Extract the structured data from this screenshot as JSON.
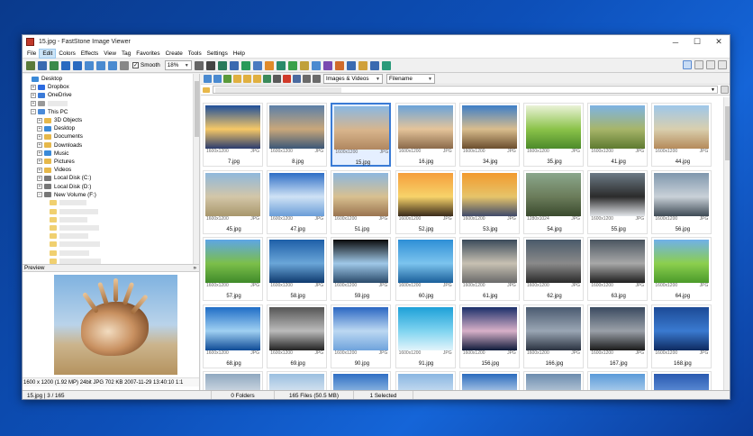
{
  "window": {
    "title": "15.jpg - FastStone Image Viewer",
    "controls": [
      "─",
      "☐",
      "✕"
    ]
  },
  "menu": [
    "File",
    "Edit",
    "Colors",
    "Effects",
    "View",
    "Tag",
    "Favorites",
    "Create",
    "Tools",
    "Settings",
    "Help"
  ],
  "toolbar": {
    "smooth_label": "Smooth",
    "smooth_checked": true,
    "zoom": "18%"
  },
  "nav": {
    "filter": "Images & Videos",
    "sort": "Filename"
  },
  "tree": {
    "items": [
      {
        "label": "Desktop",
        "exp": "",
        "indent": 0,
        "icon": "desktop"
      },
      {
        "label": "Dropbox",
        "exp": "+",
        "indent": 1,
        "icon": "dropbox"
      },
      {
        "label": "OneDrive",
        "exp": "+",
        "indent": 1,
        "icon": "cloud"
      },
      {
        "label": "",
        "exp": "+",
        "indent": 1,
        "icon": "user"
      },
      {
        "label": "This PC",
        "exp": "−",
        "indent": 1,
        "icon": "pc"
      },
      {
        "label": "3D Objects",
        "exp": "+",
        "indent": 2,
        "icon": "folder"
      },
      {
        "label": "Desktop",
        "exp": "+",
        "indent": 2,
        "icon": "desktop"
      },
      {
        "label": "Documents",
        "exp": "+",
        "indent": 2,
        "icon": "folder"
      },
      {
        "label": "Downloads",
        "exp": "+",
        "indent": 2,
        "icon": "folder"
      },
      {
        "label": "Music",
        "exp": "+",
        "indent": 2,
        "icon": "music"
      },
      {
        "label": "Pictures",
        "exp": "+",
        "indent": 2,
        "icon": "folder"
      },
      {
        "label": "Videos",
        "exp": "+",
        "indent": 2,
        "icon": "folder"
      },
      {
        "label": "Local Disk (C:)",
        "exp": "+",
        "indent": 2,
        "icon": "disk"
      },
      {
        "label": "Local Disk (D:)",
        "exp": "+",
        "indent": 2,
        "icon": "disk"
      },
      {
        "label": "New Volume (F:)",
        "exp": "−",
        "indent": 2,
        "icon": "disk"
      }
    ]
  },
  "preview": {
    "title": "Preview",
    "info": "1600 x 1200 (1.92 MP)  24bit  JPG  702 KB  2007-11-29 13:40:10  1:1"
  },
  "thumbnails": [
    {
      "name": "7.jpg",
      "dims": "1600x1200",
      "fmt": "JPG",
      "c": [
        "#1f4f9a",
        "#f6c866",
        "#2a3b6e"
      ]
    },
    {
      "name": "8.jpg",
      "dims": "1600x1200",
      "fmt": "JPG",
      "c": [
        "#5b7fa8",
        "#c9a77a",
        "#3b5778"
      ]
    },
    {
      "name": "15.jpg",
      "dims": "1600x1200",
      "fmt": "JPG",
      "c": [
        "#8ab8e3",
        "#d8b58c",
        "#b08760"
      ],
      "sel": true
    },
    {
      "name": "16.jpg",
      "dims": "1600x1200",
      "fmt": "JPG",
      "c": [
        "#6aa3d9",
        "#e4c49a",
        "#8b6a4a"
      ]
    },
    {
      "name": "34.jpg",
      "dims": "1600x1200",
      "fmt": "JPG",
      "c": [
        "#3d7ec7",
        "#d9bd8d",
        "#6b4e2e"
      ]
    },
    {
      "name": "35.jpg",
      "dims": "1600x1200",
      "fmt": "JPG",
      "c": [
        "#eaf2d8",
        "#8bc34a",
        "#4c8a2a"
      ]
    },
    {
      "name": "41.jpg",
      "dims": "1600x1200",
      "fmt": "JPG",
      "c": [
        "#7db3e4",
        "#a7b56a",
        "#5e7a30"
      ]
    },
    {
      "name": "44.jpg",
      "dims": "1600x1200",
      "fmt": "JPG",
      "c": [
        "#9ec7ea",
        "#d9cfae",
        "#b58a5a"
      ]
    },
    {
      "name": "45.jpg",
      "dims": "1600x1200",
      "fmt": "JPG",
      "c": [
        "#8fb8dc",
        "#d3c6a8",
        "#a8976c"
      ]
    },
    {
      "name": "47.jpg",
      "dims": "1600x1200",
      "fmt": "JPG",
      "c": [
        "#2e6ec6",
        "#cfe2f5",
        "#6a9dd8"
      ]
    },
    {
      "name": "51.jpg",
      "dims": "1600x1200",
      "fmt": "JPG",
      "c": [
        "#8db7de",
        "#d8c090",
        "#9a7450"
      ]
    },
    {
      "name": "52.jpg",
      "dims": "1600x1200",
      "fmt": "JPG",
      "c": [
        "#f59e3b",
        "#f7d36a",
        "#3a2a1a"
      ]
    },
    {
      "name": "53.jpg",
      "dims": "1600x1200",
      "fmt": "JPG",
      "c": [
        "#f29a2e",
        "#e6c46a",
        "#3f4a6a"
      ]
    },
    {
      "name": "54.jpg",
      "dims": "1280x1024",
      "fmt": "JPG",
      "c": [
        "#8aa78c",
        "#6b7c5a",
        "#3a4a2e"
      ]
    },
    {
      "name": "55.jpg",
      "dims": "1600x1200",
      "fmt": "JPG",
      "c": [
        "#6c7a86",
        "#2b2b2b",
        "#e3e6ea"
      ]
    },
    {
      "name": "56.jpg",
      "dims": "1600x1200",
      "fmt": "JPG",
      "c": [
        "#7f97ad",
        "#c9d1d8",
        "#3e4a55"
      ]
    },
    {
      "name": "57.jpg",
      "dims": "1600x1200",
      "fmt": "JPG",
      "c": [
        "#5da5e6",
        "#7cbf4a",
        "#3f8a2a"
      ]
    },
    {
      "name": "58.jpg",
      "dims": "1600x1200",
      "fmt": "JPG",
      "c": [
        "#1e5fa8",
        "#6aa6d8",
        "#0e3a6e"
      ]
    },
    {
      "name": "59.jpg",
      "dims": "1600x1200",
      "fmt": "JPG",
      "c": [
        "#0a0a0a",
        "#9fc8e8",
        "#2a4a6a"
      ]
    },
    {
      "name": "60.jpg",
      "dims": "1600x1200",
      "fmt": "JPG",
      "c": [
        "#2e8fd6",
        "#7cc4ee",
        "#1a5f9a"
      ]
    },
    {
      "name": "61.jpg",
      "dims": "1600x1200",
      "fmt": "JPG",
      "c": [
        "#3a4a5a",
        "#c7c0b2",
        "#6a6a6a"
      ]
    },
    {
      "name": "62.jpg",
      "dims": "1600x1200",
      "fmt": "JPG",
      "c": [
        "#4a5a6a",
        "#8a8a8a",
        "#2a2a2a"
      ]
    },
    {
      "name": "63.jpg",
      "dims": "1600x1200",
      "fmt": "JPG",
      "c": [
        "#4a5560",
        "#a8a8a8",
        "#1e1e1e"
      ]
    },
    {
      "name": "64.jpg",
      "dims": "1600x1200",
      "fmt": "JPG",
      "c": [
        "#6fb0ea",
        "#8ccf4e",
        "#4a9a2a"
      ]
    },
    {
      "name": "68.jpg",
      "dims": "1600x1200",
      "fmt": "JPG",
      "c": [
        "#1f6dc6",
        "#9fd0f2",
        "#0e4a96"
      ]
    },
    {
      "name": "69.jpg",
      "dims": "1600x1200",
      "fmt": "JPG",
      "c": [
        "#555",
        "#bbb",
        "#222"
      ]
    },
    {
      "name": "90.jpg",
      "dims": "1600x1200",
      "fmt": "JPG",
      "c": [
        "#2a66c2",
        "#bcd8f2",
        "#6fa3dc"
      ]
    },
    {
      "name": "91.jpg",
      "dims": "1600x1200",
      "fmt": "JPG",
      "c": [
        "#1da0d8",
        "#7fd4f0",
        "#e2f4fb"
      ]
    },
    {
      "name": "156.jpg",
      "dims": "1600x1200",
      "fmt": "JPG",
      "c": [
        "#1b2f6a",
        "#d8b0c8",
        "#0e1a3a"
      ]
    },
    {
      "name": "166.jpg",
      "dims": "1600x1200",
      "fmt": "JPG",
      "c": [
        "#4a5a70",
        "#9aa6b4",
        "#2a3240"
      ]
    },
    {
      "name": "167.jpg",
      "dims": "1600x1200",
      "fmt": "JPG",
      "c": [
        "#3a4a60",
        "#9aa0a8",
        "#1a1a1a"
      ]
    },
    {
      "name": "168.jpg",
      "dims": "1600x1200",
      "fmt": "JPG",
      "c": [
        "#1c4a96",
        "#3a7ad0",
        "#0e2a60"
      ]
    },
    {
      "name": "",
      "dims": "",
      "fmt": "",
      "c": [
        "#8fa8c0",
        "#e0e6ec",
        "#6a7a8a"
      ]
    },
    {
      "name": "",
      "dims": "",
      "fmt": "",
      "c": [
        "#9bbfe0",
        "#e7eef5",
        "#7a9ab8"
      ]
    },
    {
      "name": "",
      "dims": "",
      "fmt": "",
      "c": [
        "#2f6fc4",
        "#a8cbe9",
        "#1a4a8a"
      ]
    },
    {
      "name": "",
      "dims": "",
      "fmt": "",
      "c": [
        "#8ab6e2",
        "#d6e6f4",
        "#5a86b8"
      ]
    },
    {
      "name": "",
      "dims": "",
      "fmt": "",
      "c": [
        "#2b6bbd",
        "#cfe0f2",
        "#1a4a8a"
      ]
    },
    {
      "name": "",
      "dims": "",
      "fmt": "",
      "c": [
        "#6c8cae",
        "#c9d6e2",
        "#3a5a7a"
      ]
    },
    {
      "name": "",
      "dims": "",
      "fmt": "",
      "c": [
        "#5a9ad8",
        "#c4dcf2",
        "#2a5a9a"
      ]
    },
    {
      "name": "",
      "dims": "",
      "fmt": "",
      "c": [
        "#2a5ab0",
        "#6a9ae0",
        "#1a3a7a"
      ]
    }
  ],
  "status": {
    "counter": "15.jpg  |  3 / 165",
    "folders": "0 Folders",
    "files": "165 Files (50.5 MB)",
    "selected": "1 Selected"
  },
  "colors": {
    "accent": "#3a7bd5",
    "selection": "#e5efff"
  }
}
